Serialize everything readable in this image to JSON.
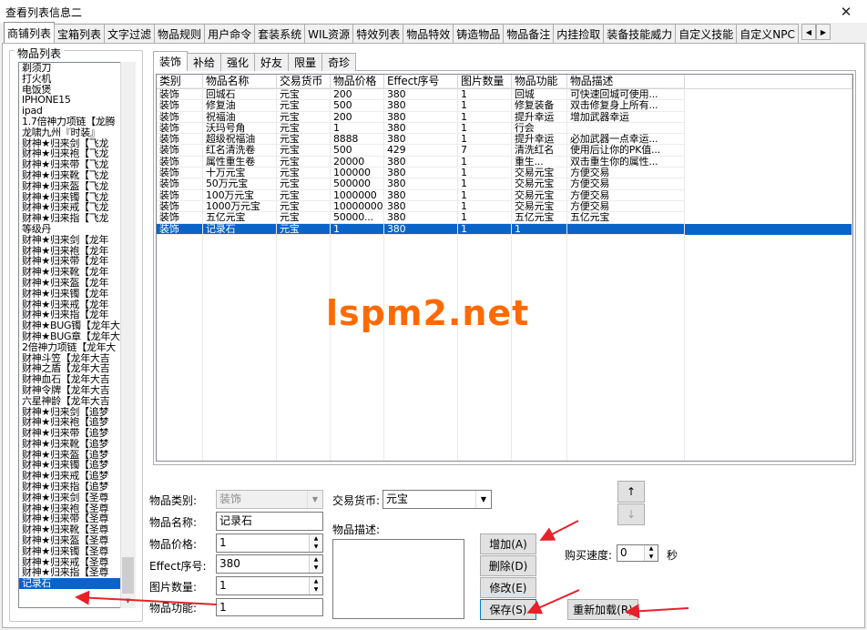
{
  "window": {
    "title": "查看列表信息二",
    "close_glyph": "✕"
  },
  "main_tabs": [
    "商铺列表",
    "宝箱列表",
    "文字过滤",
    "物品规则",
    "用户命令",
    "套装系统",
    "WIL资源",
    "特效列表",
    "物品特效",
    "铸造物品",
    "物品备注",
    "内挂捡取",
    "装备技能威力",
    "自定义技能",
    "自定义NPC"
  ],
  "main_tab_active": 0,
  "item_list": {
    "legend": "物品列表",
    "items": [
      "剃须刀",
      "打火机",
      "电饭煲",
      "IPHONE15",
      "ipad",
      "1.7倍神力项链【龙腾",
      "龙啸九州『时装』",
      "财神★归来剑【飞龙",
      "财神★归来袍【飞龙",
      "财神★归来带【飞龙",
      "财神★归来靴【飞龙",
      "财神★归来盔【飞龙",
      "财神★归来镯【飞龙",
      "财神★归来戒【飞龙",
      "财神★归来指【飞龙",
      "等级丹",
      "财神★归来剑【龙年",
      "财神★归来袍【龙年",
      "财神★归来带【龙年",
      "财神★归来靴【龙年",
      "财神★归来盔【龙年",
      "财神★归来镯【龙年",
      "财神★归来戒【龙年",
      "财神★归来指【龙年",
      "财神★BUG镯【龙年大",
      "财神★BUG章【龙年大",
      "2倍神力项链【龙年大",
      "财神斗笠【龙年大吉",
      "财神之盾【龙年大吉",
      "财神血石【龙年大吉",
      "财神令牌【龙年大吉",
      "六星神龄【龙年大吉",
      "财神★归来剑【追梦",
      "财神★归来袍【追梦",
      "财神★归来带【追梦",
      "财神★归来靴【追梦",
      "财神★归来盔【追梦",
      "财神★归来镯【追梦",
      "财神★归来戒【追梦",
      "财神★归来指【追梦",
      "财神★归来剑【圣尊",
      "财神★归来袍【圣尊",
      "财神★归来带【圣尊",
      "财神★归来靴【圣尊",
      "财神★归来盔【圣尊",
      "财神★归来镯【圣尊",
      "财神★归来戒【圣尊",
      "财神★归来指【圣尊",
      "记录石"
    ],
    "selected_index": 48
  },
  "sub_tabs": [
    "装饰",
    "补给",
    "强化",
    "好友",
    "限量",
    "奇珍"
  ],
  "sub_tab_active": 0,
  "grid": {
    "columns": [
      "类别",
      "物品名称",
      "交易货币",
      "物品价格",
      "Effect序号",
      "图片数量",
      "物品功能",
      "物品描述"
    ],
    "rows": [
      [
        "装饰",
        "回城石",
        "元宝",
        "200",
        "380",
        "1",
        "回城",
        "可快速回城可使用..."
      ],
      [
        "装饰",
        "修复油",
        "元宝",
        "500",
        "380",
        "1",
        "修复装备",
        "双击修复身上所有..."
      ],
      [
        "装饰",
        "祝福油",
        "元宝",
        "200",
        "380",
        "1",
        "提升幸运",
        "增加武器幸运"
      ],
      [
        "装饰",
        "沃玛号角",
        "元宝",
        "1",
        "380",
        "1",
        "行会",
        ""
      ],
      [
        "装饰",
        "超级祝福油",
        "元宝",
        "8888",
        "380",
        "1",
        "提升幸运",
        "必加武器一点幸运..."
      ],
      [
        "装饰",
        "红名清洗卷",
        "元宝",
        "500",
        "429",
        "7",
        "清洗红名",
        "使用后让你的PK值..."
      ],
      [
        "装饰",
        "属性重生卷",
        "元宝",
        "20000",
        "380",
        "1",
        "重生...",
        "双击重生你的属性..."
      ],
      [
        "装饰",
        "十万元宝",
        "元宝",
        "100000",
        "380",
        "1",
        "交易元宝",
        "方便交易"
      ],
      [
        "装饰",
        "50万元宝",
        "元宝",
        "500000",
        "380",
        "1",
        "交易元宝",
        "方便交易"
      ],
      [
        "装饰",
        "100万元宝",
        "元宝",
        "1000000",
        "380",
        "1",
        "交易元宝",
        "方便交易"
      ],
      [
        "装饰",
        "1000万元宝",
        "元宝",
        "10000000",
        "380",
        "1",
        "交易元宝",
        "方便交易"
      ],
      [
        "装饰",
        "五亿元宝",
        "元宝",
        "50000...",
        "380",
        "1",
        "五亿元宝",
        "五亿元宝"
      ],
      [
        "装饰",
        "记录石",
        "元宝",
        "1",
        "380",
        "1",
        "1",
        ""
      ]
    ],
    "selected_row": 12
  },
  "form": {
    "category_label": "物品类别:",
    "category_value": "装饰",
    "currency_label": "交易货币:",
    "currency_value": "元宝",
    "name_label": "物品名称:",
    "name_value": "记录石",
    "price_label": "物品价格:",
    "price_value": "1",
    "effect_label": "Effect序号:",
    "effect_value": "380",
    "imgcount_label": "图片数量:",
    "imgcount_value": "1",
    "function_label": "物品功能:",
    "function_value": "1",
    "desc_label": "物品描述:",
    "speed_label": "购买速度:",
    "speed_value": "0",
    "speed_unit": "秒"
  },
  "buttons": {
    "add": "增加(A)",
    "delete": "删除(D)",
    "modify": "修改(E)",
    "save": "保存(S)",
    "reload": "重新加载(R)",
    "up": "↑",
    "down": "↓"
  },
  "watermark": "lspm2.net",
  "colors": {
    "selection": "#0a64c8",
    "watermark": "#ff6a00",
    "annotation_arrow": "#e8202a"
  }
}
